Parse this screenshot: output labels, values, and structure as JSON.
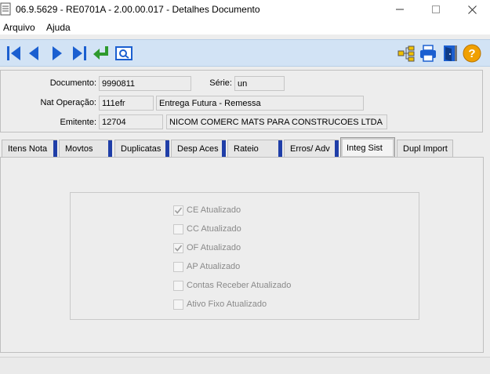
{
  "window": {
    "title": "06.9.5629 - RE0701A - 2.00.00.017 - Detalhes Documento",
    "minimize_glyph": "—",
    "maximize_glyph": "☐",
    "close_glyph": "✕"
  },
  "menu": {
    "items": [
      "Arquivo",
      "Ajuda"
    ]
  },
  "toolbar": {
    "nav_icons": [
      "first-record-icon",
      "previous-record-icon",
      "next-record-icon",
      "last-record-icon",
      "return-icon",
      "zoom-icon"
    ],
    "right_icons": [
      "tree-icon",
      "print-icon",
      "exit-door-icon",
      "help-icon"
    ],
    "help_glyph": "?"
  },
  "header": {
    "documento_label": "Documento:",
    "documento_value": "9990811",
    "serie_label": "Série:",
    "serie_value": "un",
    "nat_operacao_label": "Nat Operação:",
    "nat_operacao_code": "111efr",
    "nat_operacao_desc": "Entrega Futura - Remessa",
    "emitente_label": "Emitente:",
    "emitente_code": "12704",
    "emitente_name": "NICOM COMERC MATS PARA CONSTRUCOES LTDA"
  },
  "tabs": [
    {
      "label": "Itens Nota"
    },
    {
      "label": "Movtos"
    },
    {
      "label": "Duplicatas"
    },
    {
      "label": "Desp Aces"
    },
    {
      "label": "Rateio"
    },
    {
      "label": "Erros/ Adv"
    },
    {
      "label": "Integ Sist",
      "active": true
    },
    {
      "label": "Dupl Import"
    }
  ],
  "integ_sist": {
    "checkboxes": [
      {
        "label": "CE Atualizado",
        "checked": true
      },
      {
        "label": "CC Atualizado",
        "checked": false
      },
      {
        "label": "OF Atualizado",
        "checked": true
      },
      {
        "label": "AP Atualizado",
        "checked": false
      },
      {
        "label": "Contas Receber Atualizado",
        "checked": false
      },
      {
        "label": "Ativo Fixo Atualizado",
        "checked": false
      }
    ],
    "check_glyph": "✓"
  },
  "colors": {
    "toolbar_bg": "#d2e3f5",
    "nav_blue": "#1b5fd0",
    "return_green": "#2e9a2e",
    "help_orange": "#f0a000",
    "tab_accent": "#1f3ea8"
  }
}
